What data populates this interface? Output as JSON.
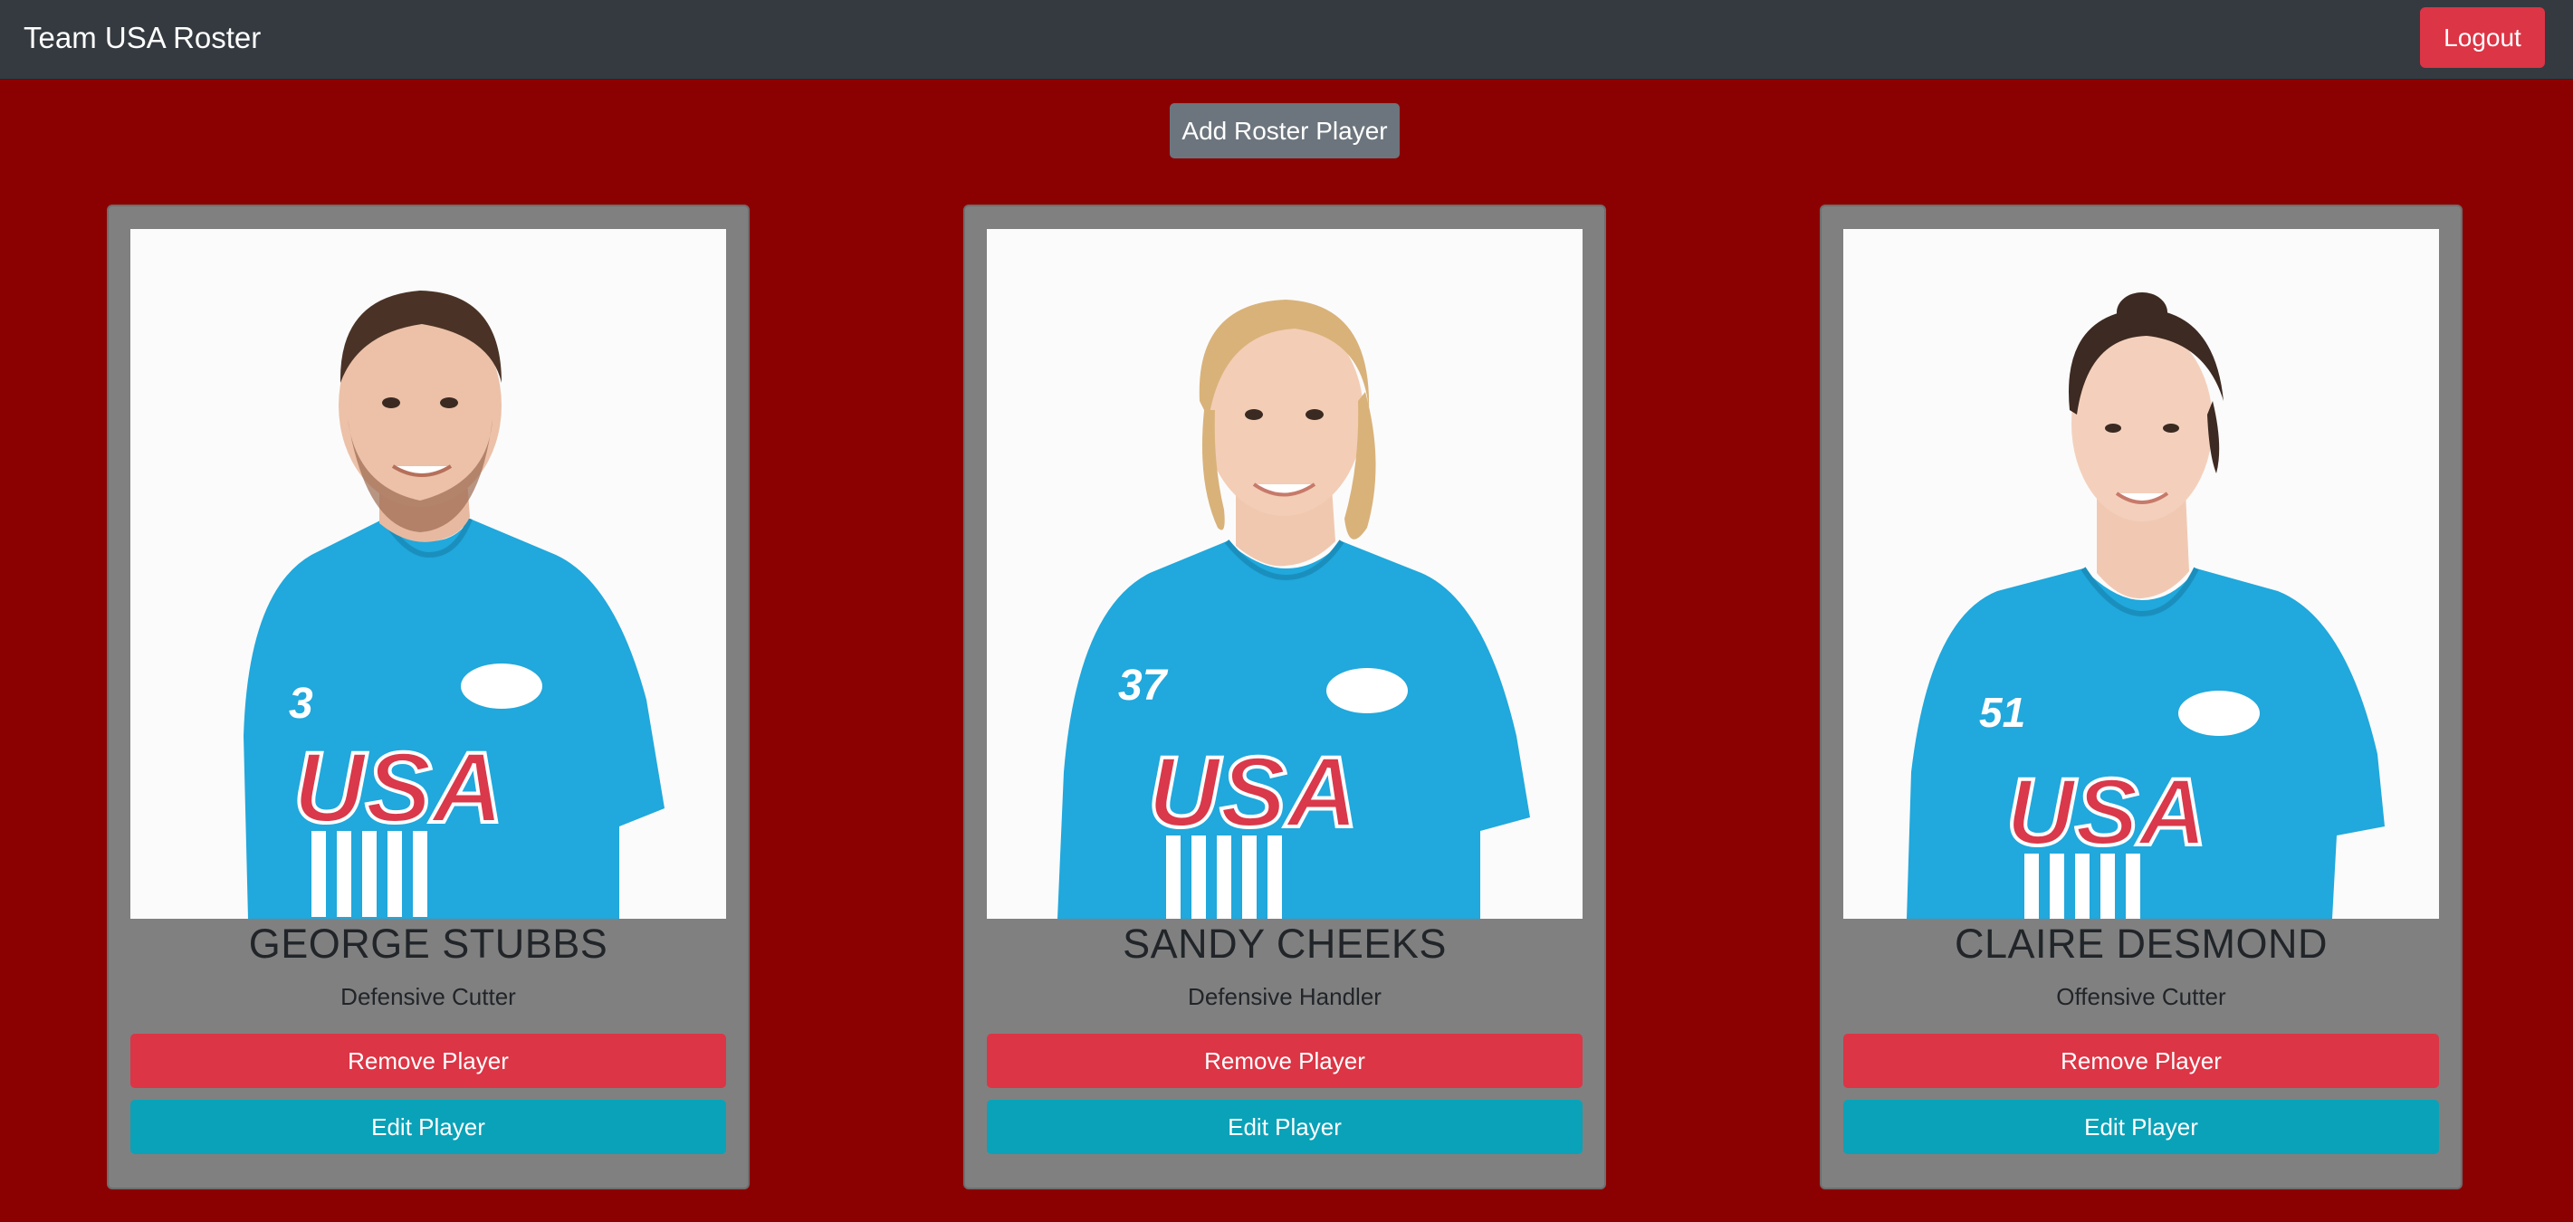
{
  "navbar": {
    "brand": "Team USA Roster",
    "logout_label": "Logout"
  },
  "actions": {
    "add_label": "Add Roster Player"
  },
  "players": [
    {
      "name": "GEORGE STUBBS",
      "position": "Defensive Cutter",
      "jersey_number": "3",
      "jersey_text": "USA",
      "remove_label": "Remove Player",
      "edit_label": "Edit Player"
    },
    {
      "name": "SANDY CHEEKS",
      "position": "Defensive Handler",
      "jersey_number": "37",
      "jersey_text": "USA",
      "remove_label": "Remove Player",
      "edit_label": "Edit Player"
    },
    {
      "name": "CLAIRE DESMOND",
      "position": "Offensive Cutter",
      "jersey_number": "51",
      "jersey_text": "USA",
      "remove_label": "Remove Player",
      "edit_label": "Edit Player"
    }
  ],
  "colors": {
    "page_background": "#8b0000",
    "navbar": "#343a40",
    "card": "#808080",
    "danger": "#dc3545",
    "info": "#0aa2b8",
    "secondary": "#6c757d",
    "jersey": "#21a8dc"
  }
}
